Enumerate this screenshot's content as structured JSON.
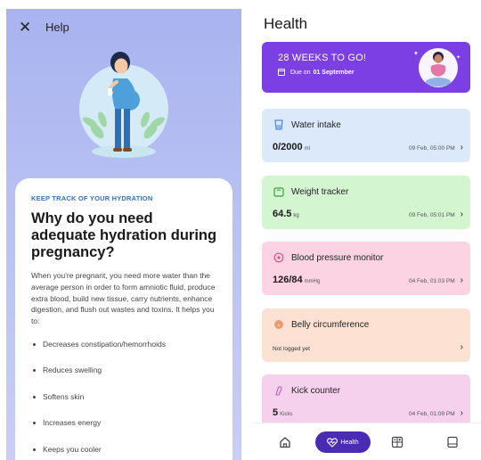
{
  "help_screen": {
    "title": "Help",
    "close_icon": "close-icon",
    "kicker": "KEEP TRACK OF YOUR HYDRATION",
    "headline": "Why do you need adequate hydration during pregnancy?",
    "body": "When you're pregnant, you need more water than the average person in order to form amniotic fluid, produce extra blood, build new tissue, carry nutrients, enhance digestion, and flush out wastes and toxins. It helps you to:",
    "bullets": [
      "Decreases constipation/hemorrhoids",
      "Reduces swelling",
      "Softens skin",
      "Increases energy",
      "Keeps you cooler"
    ]
  },
  "health_screen": {
    "title": "Health",
    "banner": {
      "title": "28 WEEKS TO GO!",
      "due_prefix": "Due on",
      "due_date": "01 September",
      "color": "#7b3fe4"
    },
    "trackers": [
      {
        "title": "Water intake",
        "value": "0/2000",
        "unit": "ml",
        "time": "09 Feb, 05:00 PM",
        "icon": "water-glass-icon",
        "color": "#dce9fb"
      },
      {
        "title": "Weight tracker",
        "value": "64.5",
        "unit": "kg",
        "time": "09 Feb, 05:01 PM",
        "icon": "weighing-scale-icon",
        "color": "#d3f5cf"
      },
      {
        "title": "Blood pressure monitor",
        "value": "126/84",
        "unit": "mmHg",
        "time": "04 Feb, 01:03 PM",
        "icon": "blood-pressure-icon",
        "color": "#fbd3e3"
      },
      {
        "title": "Belly circumference",
        "empty": "Not logged yet",
        "icon": "belly-icon",
        "color": "#fde2d4"
      },
      {
        "title": "Kick counter",
        "value": "5",
        "unit": "Kicks",
        "time": "04 Feb, 01:09 PM",
        "icon": "foot-kick-icon",
        "color": "#f5d1ee"
      }
    ]
  },
  "bottom_nav": {
    "active_label": "Health",
    "accent": "#4a2bb3",
    "items": [
      "home-icon",
      "health-icon",
      "tools-icon",
      "journal-icon"
    ]
  }
}
